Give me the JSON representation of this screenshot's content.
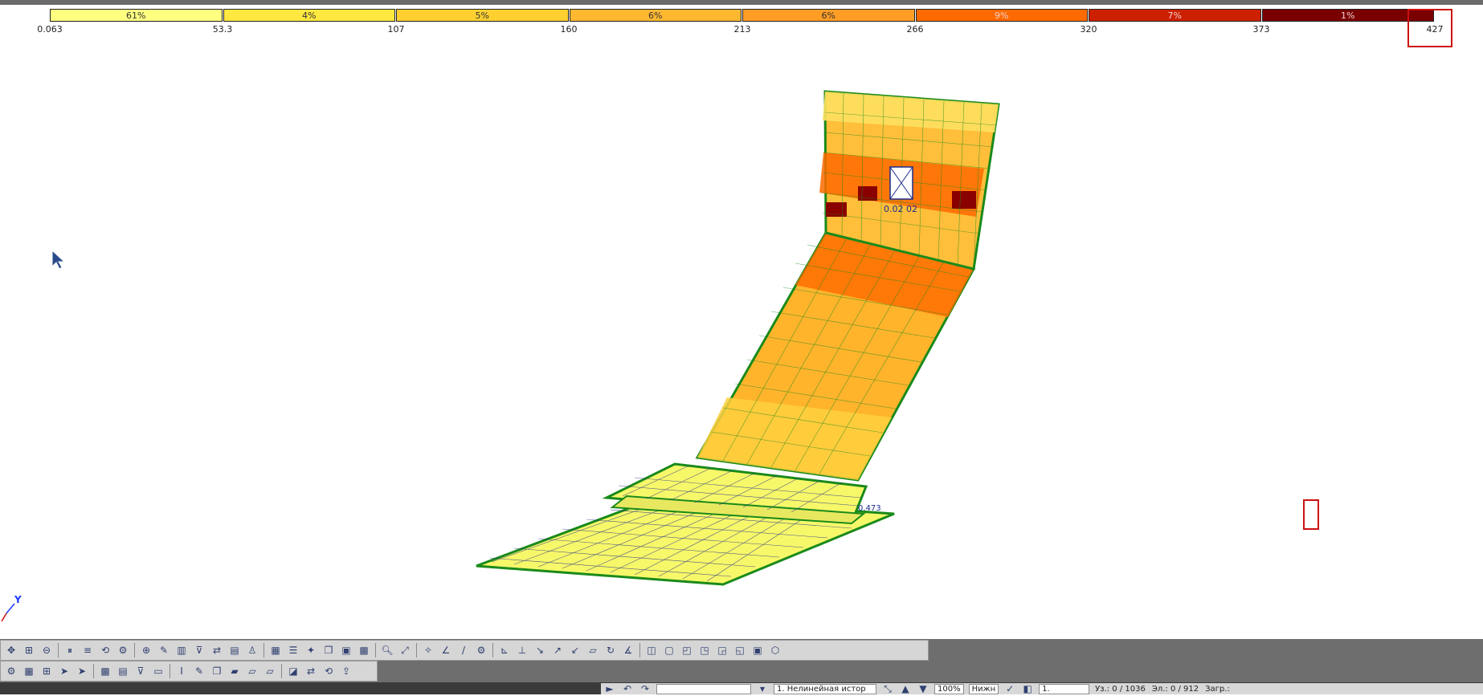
{
  "legend": {
    "segments": [
      {
        "label": "61%",
        "color": "#ffff80"
      },
      {
        "label": "4%",
        "color": "#ffe840"
      },
      {
        "label": "5%",
        "color": "#ffd030"
      },
      {
        "label": "6%",
        "color": "#ffb830"
      },
      {
        "label": "6%",
        "color": "#ff9d25"
      },
      {
        "label": "9%",
        "color": "#ff6a00"
      },
      {
        "label": "7%",
        "color": "#cc2000"
      },
      {
        "label": "1%",
        "color": "#7a0000"
      }
    ],
    "ticks": [
      "0.063",
      "53.3",
      "107",
      "160",
      "213",
      "266",
      "320",
      "373",
      "427"
    ]
  },
  "model": {
    "label_near_hole": "0.02 02",
    "label_bottom_right": "0.473"
  },
  "axis": {
    "y_label": "Y"
  },
  "status": {
    "field1": "",
    "history": "1. Нелинейная истор",
    "zoom": "100%",
    "view": "Нижн",
    "field_one": "1.",
    "nodes": "Уз.: 0 / 1036",
    "elements": "Эл.: 0 / 912",
    "load": "Загр.:"
  },
  "colors": {
    "toolbar_bg": "#d6d6d6",
    "mesh_green": "#1a8a1a",
    "highlight_red": "#cc1010"
  }
}
